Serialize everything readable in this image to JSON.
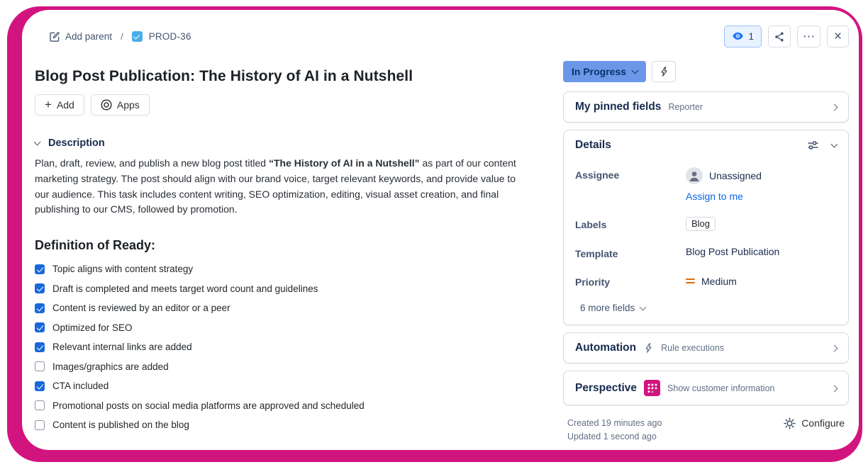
{
  "colors": {
    "frame_pink": "#D2147F",
    "checkbox_blue": "#1868DB",
    "status_bg": "#6B97E8",
    "status_text": "#09326C",
    "link_blue": "#0C66E4",
    "priority_orange": "#D97008",
    "task_icon_blue": "#4BADE8",
    "watch_bg": "#E9F2FF"
  },
  "header": {
    "add_parent_label": "Add parent",
    "separator": "/",
    "issue_key": "PROD-36",
    "watch_count": "1",
    "more_glyph": "⋯",
    "close_glyph": "×"
  },
  "title": "Blog Post Publication: The History of AI in a Nutshell",
  "toolbar": {
    "plus_glyph": "+",
    "add_label": "Add",
    "apps_label": "Apps"
  },
  "description": {
    "heading": "Description",
    "text_before": "Plan, draft, review, and publish a new blog post titled ",
    "text_bold": "“The History of AI in a Nutshell”",
    "text_after": " as part of our content marketing strategy. The post should align with our brand voice, target relevant keywords, and provide value to our audience. This task includes content writing, SEO optimization, editing, visual asset creation, and final publishing to our CMS, followed by promotion."
  },
  "checklist": {
    "heading": "Definition of Ready:",
    "items": [
      {
        "label": "Topic aligns with content strategy",
        "checked": true
      },
      {
        "label": "Draft is completed and meets target word count and guidelines",
        "checked": true
      },
      {
        "label": "Content is reviewed by an editor or a peer",
        "checked": true
      },
      {
        "label": "Optimized for SEO",
        "checked": true
      },
      {
        "label": "Relevant internal links are added",
        "checked": true
      },
      {
        "label": "Images/graphics are added",
        "checked": false
      },
      {
        "label": "CTA included",
        "checked": true
      },
      {
        "label": "Promotional posts on social media platforms are approved and scheduled",
        "checked": false
      },
      {
        "label": "Content is published on the blog",
        "checked": false
      }
    ]
  },
  "sidebar": {
    "status_label": "In Progress",
    "pinned": {
      "title": "My pinned fields",
      "subtitle": "Reporter"
    },
    "details": {
      "title": "Details",
      "assignee": {
        "label": "Assignee",
        "value": "Unassigned",
        "action": "Assign to me"
      },
      "labels": {
        "label": "Labels",
        "value": "Blog"
      },
      "template": {
        "label": "Template",
        "value": "Blog Post Publication"
      },
      "priority": {
        "label": "Priority",
        "value": "Medium"
      },
      "more_fields": "6 more fields"
    },
    "automation": {
      "title": "Automation",
      "subtitle": "Rule executions"
    },
    "perspective": {
      "title": "Perspective",
      "subtitle": "Show customer information"
    }
  },
  "footer": {
    "created": "Created 19 minutes ago",
    "updated": "Updated 1 second ago",
    "configure_label": "Configure"
  }
}
